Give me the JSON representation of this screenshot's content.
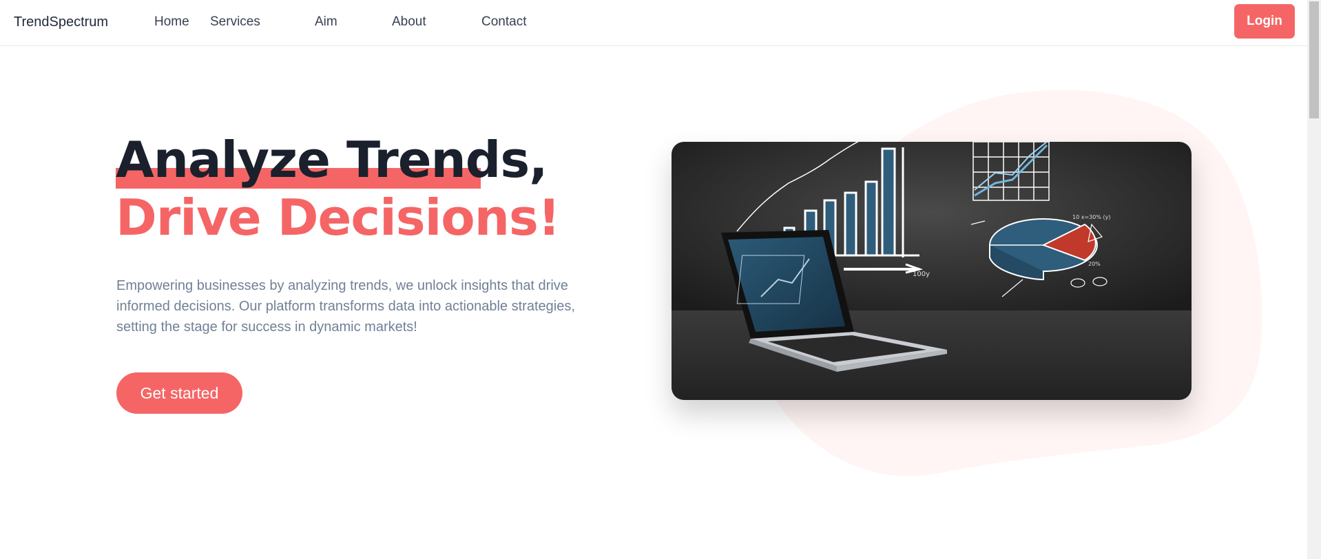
{
  "nav": {
    "brand": "TrendSpectrum",
    "links": [
      "Home",
      "Services",
      "Aim",
      "About",
      "Contact"
    ],
    "login_label": "Login"
  },
  "hero": {
    "title_line1": "Analyze Trends,",
    "title_line2": "Drive Decisions!",
    "description": "Empowering businesses by analyzing trends, we unlock insights that drive informed decisions. Our platform transforms data into actionable strategies, setting the stage for success in dynamic markets!",
    "cta_label": "Get started",
    "image_annotations": {
      "pct_20": "20%",
      "bar_100": "100y",
      "pct_10": "10 x=30% (y)"
    }
  },
  "colors": {
    "accent": "#f56565",
    "blob": "#fff5f4",
    "heading": "#1a202c",
    "body_text": "#718096"
  },
  "icons": {
    "scroll": "scrollbar",
    "image": "laptop-chart-illustration"
  }
}
